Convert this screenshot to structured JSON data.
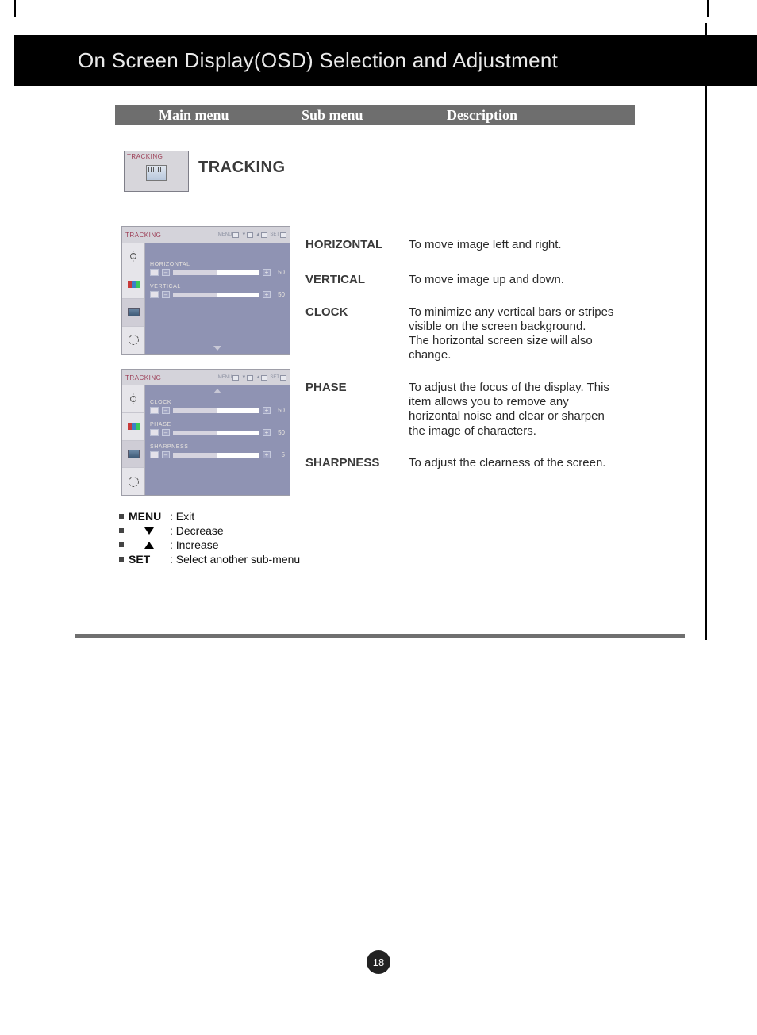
{
  "header": {
    "title": "On Screen Display(OSD) Selection and Adjustment"
  },
  "subheader": {
    "main": "Main menu",
    "sub": "Sub menu",
    "desc": "Description"
  },
  "tracking_icon": {
    "label": "TRACKING"
  },
  "tracking_heading": "TRACKING",
  "osd1": {
    "title": "TRACKING",
    "ctrl_menu": "MENU",
    "ctrl_set": "SET",
    "rows": [
      {
        "label": "HORIZONTAL",
        "value": "50"
      },
      {
        "label": "VERTICAL",
        "value": "50"
      }
    ]
  },
  "osd2": {
    "title": "TRACKING",
    "ctrl_menu": "MENU",
    "ctrl_set": "SET",
    "rows": [
      {
        "label": "CLOCK",
        "value": "50"
      },
      {
        "label": "PHASE",
        "value": "50"
      },
      {
        "label": "SHARPNESS",
        "value": "5"
      }
    ]
  },
  "settings": [
    {
      "sub": "HORIZONTAL",
      "desc": "To move image left and right."
    },
    {
      "sub": "VERTICAL",
      "desc": "To move image up and down."
    },
    {
      "sub": "CLOCK",
      "desc": "To minimize any vertical bars or stripes visible on the screen background.\nThe horizontal screen size will also change."
    },
    {
      "sub": "PHASE",
      "desc": "To adjust the focus of the display. This item allows you to remove any horizontal noise and clear or sharpen the image of characters."
    },
    {
      "sub": "SHARPNESS",
      "desc": "To adjust the clearness of the screen."
    }
  ],
  "legend": {
    "items": [
      {
        "key": "MENU",
        "desc": ": Exit"
      },
      {
        "key": "▼",
        "desc": ": Decrease"
      },
      {
        "key": "▲",
        "desc": ": Increase"
      },
      {
        "key": "SET",
        "desc": ": Select another sub-menu"
      }
    ]
  },
  "page_number": "18"
}
